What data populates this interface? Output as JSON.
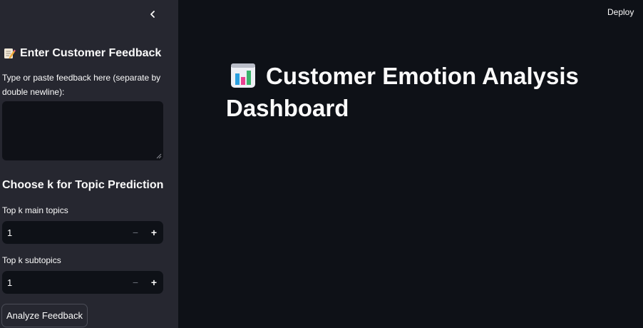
{
  "sidebar": {
    "collapse_icon": "chevron-left-icon",
    "heading_icon": "memo-icon",
    "heading": "Enter Customer Feedback",
    "feedback_label": "Type or paste feedback here (separate by double newline):",
    "feedback_value": "",
    "topic_heading": "Choose k for Topic Prediction",
    "main_topics": {
      "label": "Top k main topics",
      "value": "1",
      "decrement": "−",
      "increment": "+"
    },
    "subtopics": {
      "label": "Top k subtopics",
      "value": "1",
      "decrement": "−",
      "increment": "+"
    },
    "analyze_button": "Analyze Feedback"
  },
  "header": {
    "deploy_label": "Deploy"
  },
  "main": {
    "title_icon": "bar-chart-icon",
    "title": "Customer Emotion Analysis Dashboard"
  },
  "colors": {
    "sidebar_bg": "#262730",
    "main_bg": "#0e1117",
    "text": "#fafafa"
  }
}
